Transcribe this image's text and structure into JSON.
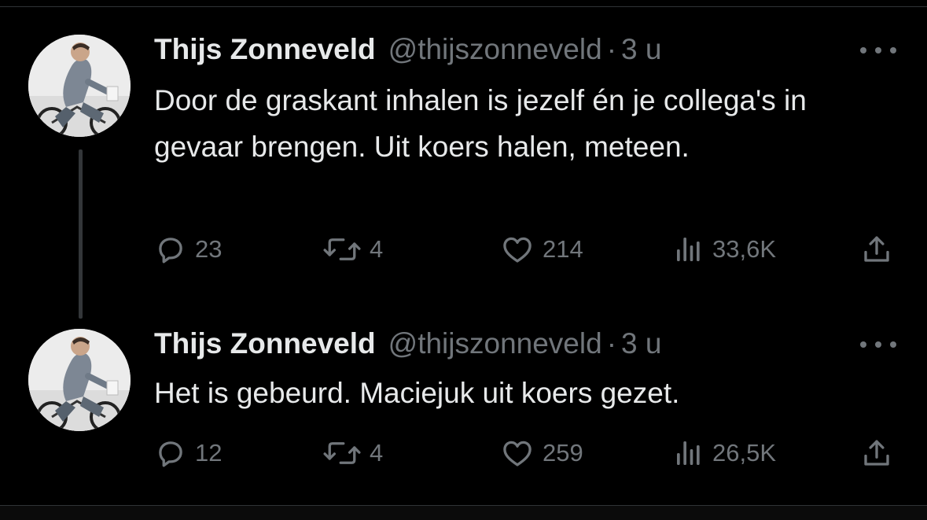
{
  "tweets": [
    {
      "name": "Thijs Zonneveld",
      "handle": "@thijszonneveld",
      "separator": "·",
      "time": "3 u",
      "text": "Door de graskant inhalen is jezelf én je collega's in gevaar brengen. Uit koers halen, meteen.",
      "replies": "23",
      "retweets": "4",
      "likes": "214",
      "views": "33,6K"
    },
    {
      "name": "Thijs Zonneveld",
      "handle": "@thijszonneveld",
      "separator": "·",
      "time": "3 u",
      "text": "Het is gebeurd. Maciejuk uit koers gezet.",
      "replies": "12",
      "retweets": "4",
      "likes": "259",
      "views": "26,5K"
    }
  ],
  "icons": {
    "reply": "speech-bubble-icon",
    "retweet": "retweet-arrows-icon",
    "like": "heart-icon",
    "views": "bar-chart-icon",
    "share": "share-upload-icon",
    "more": "more-dots-icon"
  },
  "colors": {
    "background": "#000000",
    "primary_text": "#e7e9ea",
    "secondary_text": "#71767b",
    "thread_line": "#333639"
  }
}
